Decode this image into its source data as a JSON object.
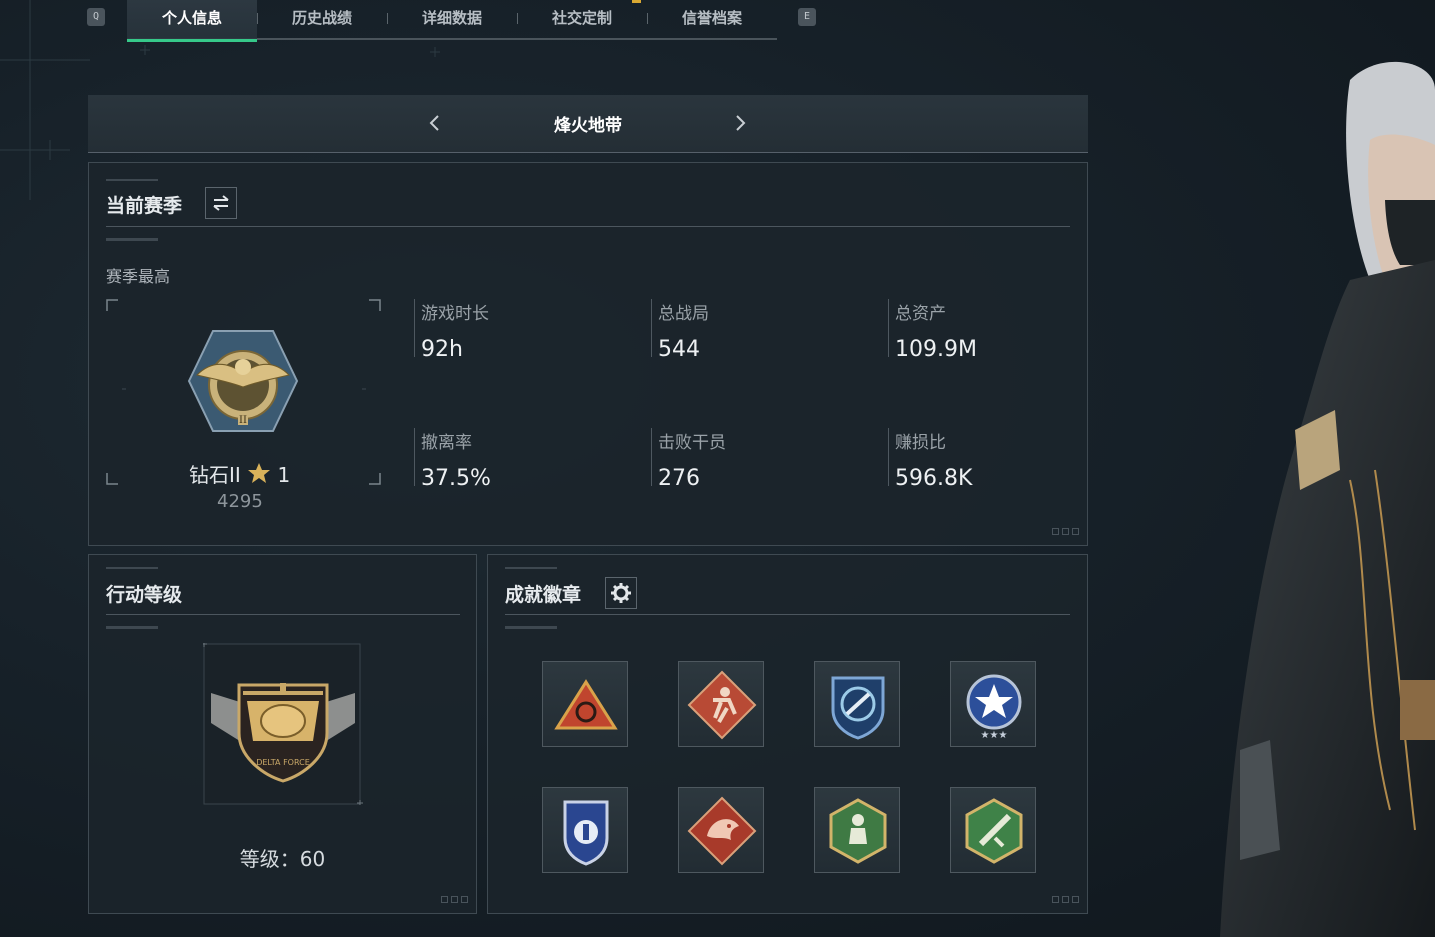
{
  "tabs": {
    "left_key": "Q",
    "right_key": "E",
    "items": [
      {
        "label": "个人信息",
        "active": true
      },
      {
        "label": "历史战绩",
        "active": false
      },
      {
        "label": "详细数据",
        "active": false
      },
      {
        "label": "社交定制",
        "active": false
      },
      {
        "label": "信誉档案",
        "active": false
      }
    ]
  },
  "mode": {
    "title": "烽火地带",
    "prev_icon": "chevron-left-icon",
    "next_icon": "chevron-right-icon"
  },
  "season": {
    "title": "当前赛季",
    "switch_icon": "swap-icon",
    "best_label": "赛季最高",
    "rank": "钻石II",
    "rank_stars": "1",
    "score": "4295",
    "stats": [
      {
        "label": "游戏时长",
        "value": "92h"
      },
      {
        "label": "总战局",
        "value": "544"
      },
      {
        "label": "总资产",
        "value": "109.9M"
      },
      {
        "label": "撤离率",
        "value": "37.5%"
      },
      {
        "label": "击败干员",
        "value": "276"
      },
      {
        "label": "赚损比",
        "value": "596.8K"
      }
    ]
  },
  "action_level": {
    "title": "行动等级",
    "level_label": "等级：",
    "level_value": "60"
  },
  "badges": {
    "title": "成就徽章",
    "settings_icon": "gear-icon",
    "items": [
      {
        "name": "triangle-target-badge",
        "color": "#c0452e"
      },
      {
        "name": "runner-badge",
        "color": "#b84a35"
      },
      {
        "name": "shield-rotate-badge",
        "color": "#2f6fa8"
      },
      {
        "name": "star-circle-badge",
        "color": "#4b6fc2"
      },
      {
        "name": "police-shield-badge",
        "color": "#3d5eb0"
      },
      {
        "name": "dragon-badge",
        "color": "#b4432f"
      },
      {
        "name": "hexagon-soldier-badge",
        "color": "#4a8a4c"
      },
      {
        "name": "hexagon-rifle-badge",
        "color": "#4d8f4d"
      }
    ]
  },
  "colors": {
    "accent": "#36c98a",
    "gold": "#d9b25a",
    "panel": "#1b242b"
  }
}
